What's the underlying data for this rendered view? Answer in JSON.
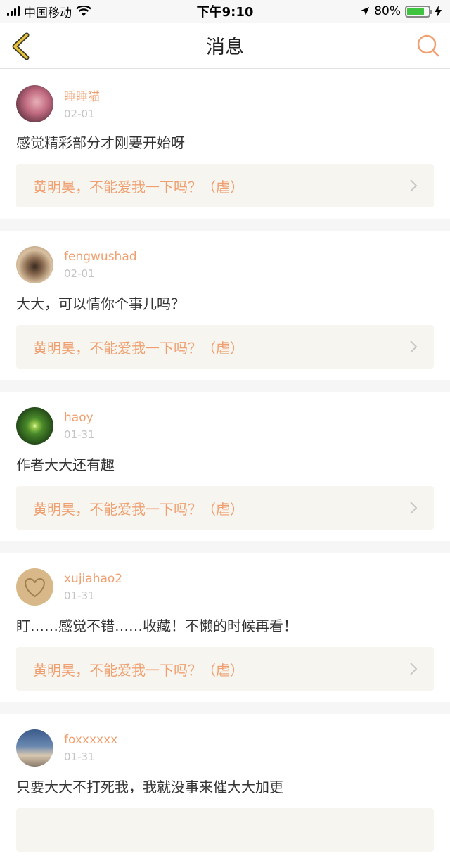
{
  "status_bar": {
    "carrier": "中国移动",
    "time": "下午9:10",
    "battery": "80%",
    "battery_level": 0.8
  },
  "header": {
    "title": "消息",
    "back_icon": "chevron-left-icon",
    "search_icon": "search-icon"
  },
  "colors": {
    "accent": "#f0a070",
    "back_arrow": "#e8c23a",
    "ref_bg": "#f6f5ef"
  },
  "messages": [
    {
      "user": "睡睡猫",
      "date": "02-01",
      "text": "感觉精彩部分才刚要开始呀",
      "ref": "黄明昊，不能爱我一下吗？（虐）"
    },
    {
      "user": "fengwushad",
      "date": "02-01",
      "text": "大大，可以情你个事儿吗？",
      "ref": "黄明昊，不能爱我一下吗？（虐）"
    },
    {
      "user": "haoy",
      "date": "01-31",
      "text": "作者大大还有趣",
      "ref": "黄明昊，不能爱我一下吗？（虐）"
    },
    {
      "user": "xujiahao2",
      "date": "01-31",
      "text": "盯……感觉不错……收藏！不懒的时候再看！",
      "ref": "黄明昊，不能爱我一下吗？（虐）"
    },
    {
      "user": "foxxxxxx",
      "date": "01-31",
      "text": "只要大大不打死我，我就没事来催大大加更",
      "ref": ""
    }
  ]
}
